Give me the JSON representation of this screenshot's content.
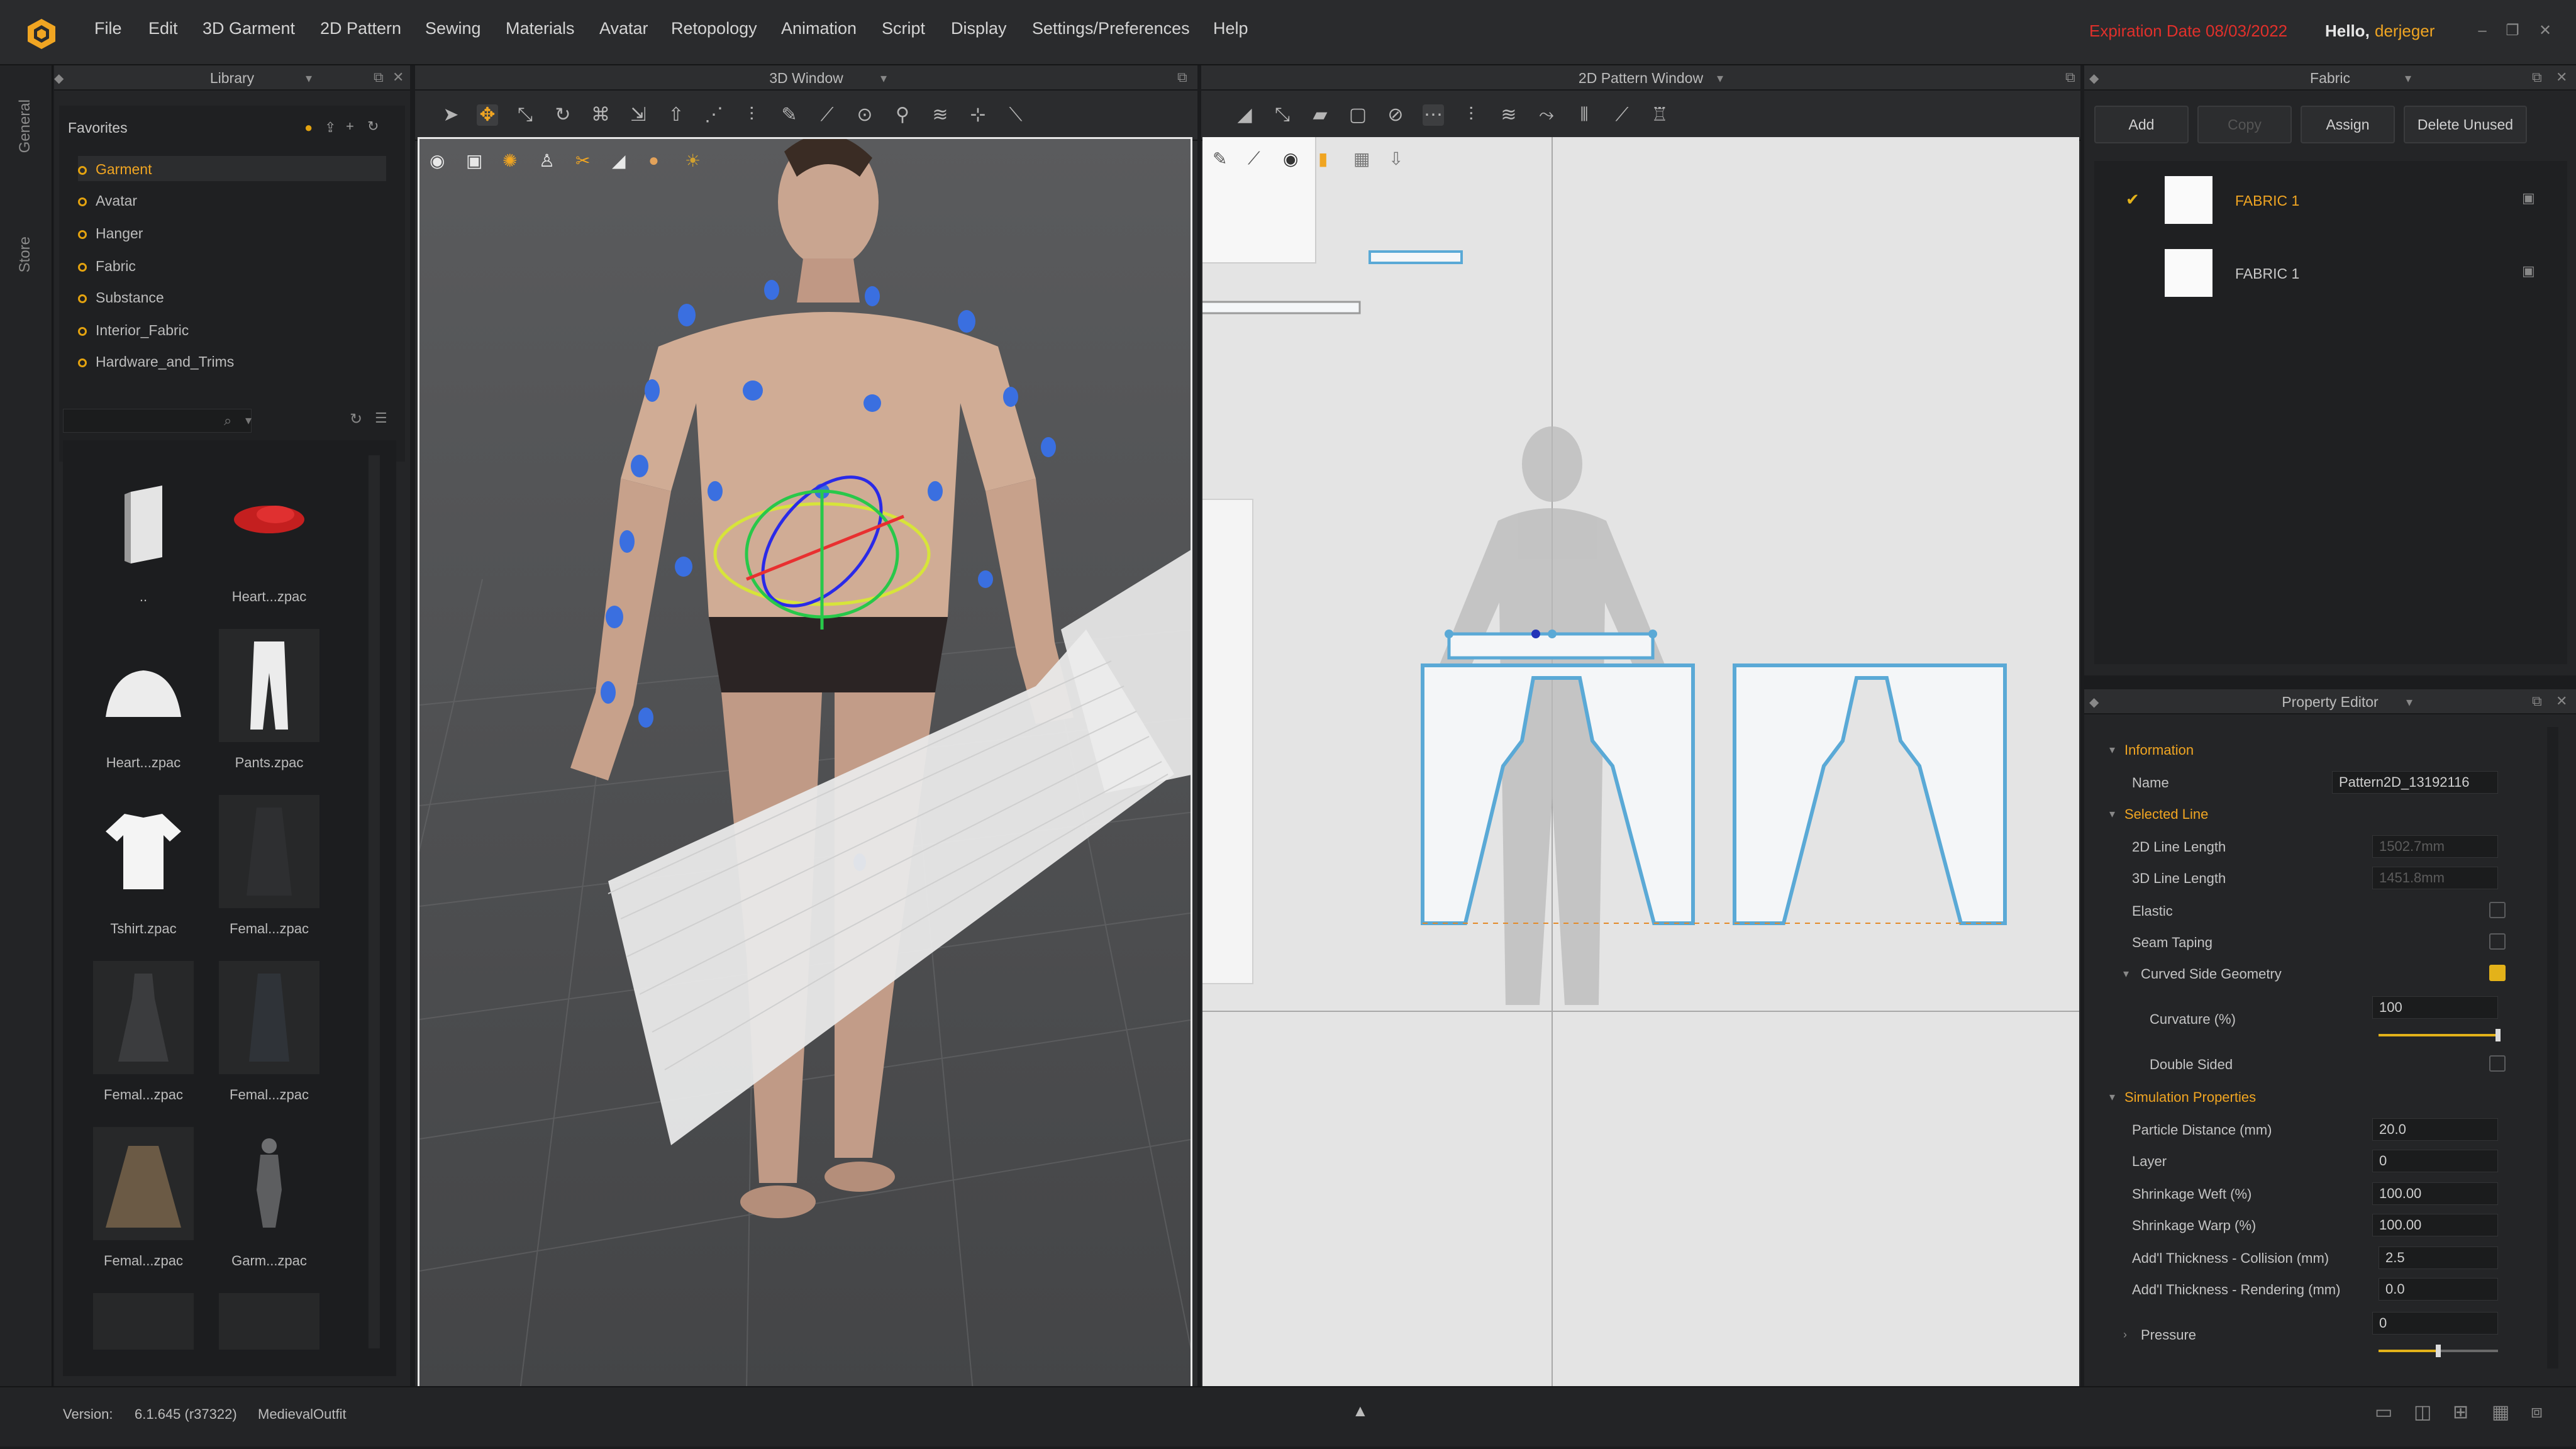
{
  "menu": {
    "items": [
      "File",
      "Edit",
      "3D Garment",
      "2D Pattern",
      "Sewing",
      "Materials",
      "Avatar",
      "Retopology",
      "Animation",
      "Script",
      "Display",
      "Settings/Preferences",
      "Help"
    ],
    "expiration": "Expiration Date 08/03/2022",
    "hello": "Hello,",
    "user": "derjeger"
  },
  "vtabs": {
    "general": "General",
    "store": "Store"
  },
  "library": {
    "title": "Library",
    "favorites_title": "Favorites",
    "favorites": [
      "Garment",
      "Avatar",
      "Hanger",
      "Fabric",
      "Substance",
      "Interior_Fabric",
      "Hardware_and_Trims"
    ],
    "thumbnails": [
      {
        "label": ".."
      },
      {
        "label": "Heart...zpac"
      },
      {
        "label": "Heart...zpac"
      },
      {
        "label": "Pants.zpac"
      },
      {
        "label": "Tshirt.zpac"
      },
      {
        "label": "Femal...zpac"
      },
      {
        "label": "Femal...zpac"
      },
      {
        "label": "Femal...zpac"
      },
      {
        "label": "Femal...zpac"
      },
      {
        "label": "Garm...zpac"
      }
    ]
  },
  "window3d": {
    "title": "3D Window"
  },
  "window2d": {
    "title": "2D Pattern Window"
  },
  "fabric": {
    "title": "Fabric",
    "buttons": {
      "add": "Add",
      "copy": "Copy",
      "assign": "Assign",
      "delete_unused": "Delete Unused"
    },
    "items": [
      {
        "name": "FABRIC 1",
        "selected": true
      },
      {
        "name": "FABRIC 1",
        "selected": false
      }
    ]
  },
  "property_editor": {
    "title": "Property Editor",
    "sections": {
      "information": "Information",
      "selected_line": "Selected Line",
      "simulation": "Simulation Properties"
    },
    "name_label": "Name",
    "name_value": "Pattern2D_13192116",
    "line_2d_label": "2D Line Length",
    "line_2d_value": "1502.7mm",
    "line_3d_label": "3D Line Length",
    "line_3d_value": "1451.8mm",
    "elastic_label": "Elastic",
    "seam_taping_label": "Seam Taping",
    "curved_label": "Curved Side Geometry",
    "curvature_label": "Curvature (%)",
    "curvature_value": "100",
    "curvature_fraction": 1.0,
    "double_sided_label": "Double Sided",
    "particle_label": "Particle Distance (mm)",
    "particle_value": "20.0",
    "layer_label": "Layer",
    "layer_value": "0",
    "weft_label": "Shrinkage Weft (%)",
    "weft_value": "100.00",
    "warp_label": "Shrinkage Warp (%)",
    "warp_value": "100.00",
    "collision_label": "Add'l Thickness - Collision (mm)",
    "collision_value": "2.5",
    "rendering_label": "Add'l Thickness - Rendering (mm)",
    "rendering_value": "0.0",
    "pressure_label": "Pressure",
    "pressure_value": "0",
    "pressure_fraction": 0.5
  },
  "status": {
    "version_label": "Version:",
    "version_value": "6.1.645 (r37322)",
    "project": "MedievalOutfit"
  },
  "colors": {
    "accent": "#f0a522",
    "expiration": "#e0302b",
    "pattern_outline": "#5aa9d6",
    "pattern_fill": "#f4f6f8"
  }
}
